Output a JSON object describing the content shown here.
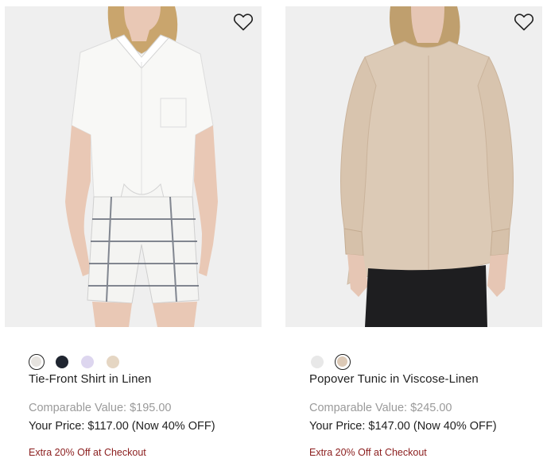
{
  "products": [
    {
      "name": "Tie-Front Shirt in Linen",
      "comparable_value": "Comparable Value: $195.00",
      "your_price": "Your Price: $117.00 (Now 40% OFF)",
      "promo": "Extra 20% Off at Checkout",
      "image_icon": "product-photo",
      "wishlist_icon": "heart-outline-icon",
      "swatches": [
        {
          "color": "#e6e3df",
          "selected": true
        },
        {
          "color": "#1f2530",
          "selected": false
        },
        {
          "color": "#ddd6ef",
          "selected": false
        },
        {
          "color": "#e5d6c3",
          "selected": false
        }
      ]
    },
    {
      "name": "Popover Tunic in Viscose-Linen",
      "comparable_value": "Comparable Value: $245.00",
      "your_price": "Your Price: $147.00 (Now 40% OFF)",
      "promo": "Extra 20% Off at Checkout",
      "image_icon": "product-photo",
      "wishlist_icon": "heart-outline-icon",
      "swatches": [
        {
          "color": "#e8e8e8",
          "selected": false
        },
        {
          "color": "#dcc9b6",
          "selected": true
        }
      ]
    }
  ],
  "colors": {
    "promo": "#8b1e1e",
    "comparable": "#9a9a9a",
    "image_bg": "#eeeeee"
  }
}
